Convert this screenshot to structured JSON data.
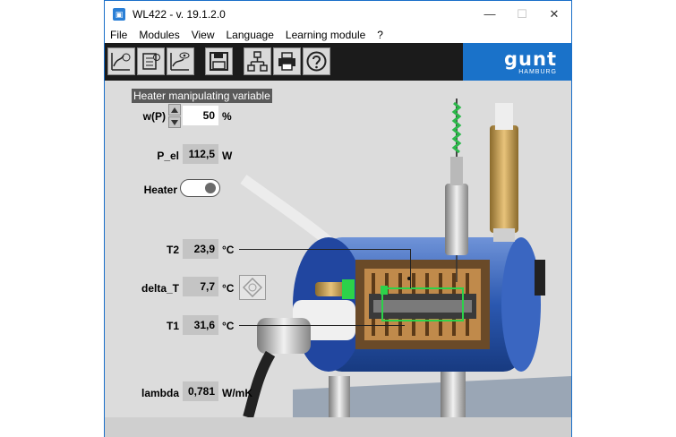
{
  "window": {
    "title": "WL422 - v. 19.1.2.0"
  },
  "menu": [
    "File",
    "Modules",
    "View",
    "Language",
    "Learning module",
    "?"
  ],
  "logo": {
    "text": "gunt",
    "sub": "HAMBURG"
  },
  "panel": {
    "section_title": "Heater manipulating variable",
    "wp": {
      "label": "w(P)",
      "value": "50",
      "unit": "%"
    },
    "pel": {
      "label": "P_el",
      "value": "112,5",
      "unit": "W"
    },
    "heater": {
      "label": "Heater",
      "state": "on"
    },
    "t2": {
      "label": "T2",
      "value": "23,9",
      "unit": "°C"
    },
    "delta_t": {
      "label": "delta_T",
      "value": "7,7",
      "unit": "°C"
    },
    "t1": {
      "label": "T1",
      "value": "31,6",
      "unit": "°C"
    },
    "lambda": {
      "label": "lambda",
      "value": "0,781",
      "unit": "W/mK"
    }
  },
  "toolbar": [
    "time-chart-icon",
    "data-logger-icon",
    "xy-chart-icon",
    "save-icon",
    "network-icon",
    "print-icon",
    "help-icon"
  ],
  "colors": {
    "titlebar_border": "#1a6fc9",
    "toolbar": "#1b1b1b",
    "logo_bg": "#1a72c9",
    "cylinder": "#2c5fb8"
  }
}
